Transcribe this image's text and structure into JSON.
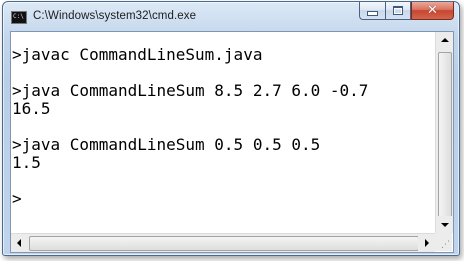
{
  "window": {
    "title": "C:\\Windows\\system32\\cmd.exe",
    "icon": "cmd-icon",
    "icon_text": "C:\\",
    "buttons": {
      "minimize": "minimize-icon",
      "maximize": "maximize-icon",
      "close": "✕"
    }
  },
  "console": {
    "lines": [
      ">javac CommandLineSum.java",
      "",
      ">java CommandLineSum 8.5 2.7 6.0 -0.7",
      "16.5",
      "",
      ">java CommandLineSum 0.5 0.5 0.5",
      "1.5",
      "",
      ">"
    ]
  },
  "colors": {
    "background": "#ffffff",
    "text": "#000000",
    "frame": "#bfd4ec"
  }
}
